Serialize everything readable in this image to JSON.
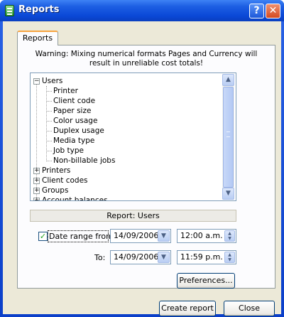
{
  "window": {
    "title": "Reports"
  },
  "tabs": [
    {
      "label": "Reports"
    }
  ],
  "warning": {
    "line1": "Warning: Mixing numerical formats Pages and Currency will",
    "line2": "result in unreliable cost totals!"
  },
  "tree": {
    "groups": [
      {
        "label": "Users",
        "expanded": true,
        "children": [
          "Printer",
          "Client code",
          "Paper size",
          "Color usage",
          "Duplex usage",
          "Media type",
          "Job type",
          "Non-billable jobs"
        ]
      },
      {
        "label": "Printers",
        "expanded": false
      },
      {
        "label": "Client codes",
        "expanded": false
      },
      {
        "label": "Groups",
        "expanded": false
      },
      {
        "label": "Account balances",
        "expanded": false
      }
    ]
  },
  "status": {
    "text": "Report: Users"
  },
  "date_range": {
    "checkbox_label": "Date range from:",
    "checked": true,
    "from_date": "14/09/2006",
    "from_time": "12:00 a.m.",
    "to_label": "To:",
    "to_date": "14/09/2006",
    "to_time": "11:59 p.m."
  },
  "buttons": {
    "preferences": "Preferences...",
    "create_report": "Create report",
    "close": "Close"
  },
  "colors": {
    "titlebar": "#0a48d6",
    "dialog_bg": "#ece9d8",
    "tab_accent": "#f7a440",
    "check": "#21a121"
  }
}
